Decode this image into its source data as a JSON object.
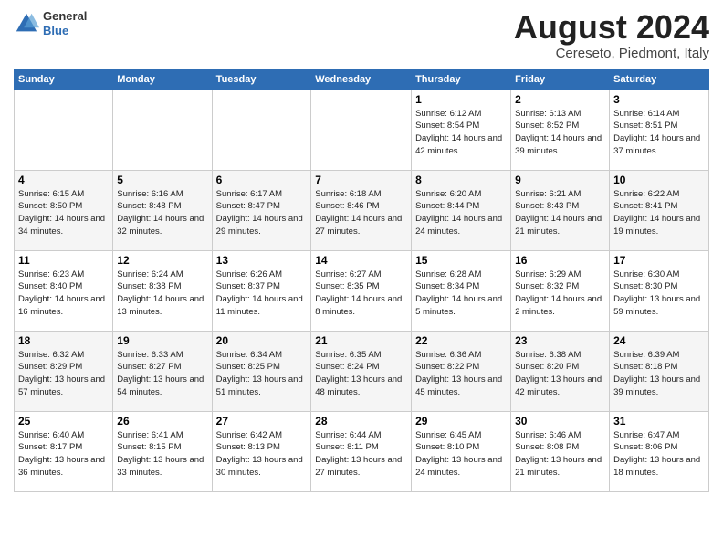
{
  "logo": {
    "general": "General",
    "blue": "Blue"
  },
  "title": "August 2024",
  "location": "Cereseto, Piedmont, Italy",
  "days_header": [
    "Sunday",
    "Monday",
    "Tuesday",
    "Wednesday",
    "Thursday",
    "Friday",
    "Saturday"
  ],
  "weeks": [
    [
      {
        "day": "",
        "info": ""
      },
      {
        "day": "",
        "info": ""
      },
      {
        "day": "",
        "info": ""
      },
      {
        "day": "",
        "info": ""
      },
      {
        "day": "1",
        "info": "Sunrise: 6:12 AM\nSunset: 8:54 PM\nDaylight: 14 hours\nand 42 minutes."
      },
      {
        "day": "2",
        "info": "Sunrise: 6:13 AM\nSunset: 8:52 PM\nDaylight: 14 hours\nand 39 minutes."
      },
      {
        "day": "3",
        "info": "Sunrise: 6:14 AM\nSunset: 8:51 PM\nDaylight: 14 hours\nand 37 minutes."
      }
    ],
    [
      {
        "day": "4",
        "info": "Sunrise: 6:15 AM\nSunset: 8:50 PM\nDaylight: 14 hours\nand 34 minutes."
      },
      {
        "day": "5",
        "info": "Sunrise: 6:16 AM\nSunset: 8:48 PM\nDaylight: 14 hours\nand 32 minutes."
      },
      {
        "day": "6",
        "info": "Sunrise: 6:17 AM\nSunset: 8:47 PM\nDaylight: 14 hours\nand 29 minutes."
      },
      {
        "day": "7",
        "info": "Sunrise: 6:18 AM\nSunset: 8:46 PM\nDaylight: 14 hours\nand 27 minutes."
      },
      {
        "day": "8",
        "info": "Sunrise: 6:20 AM\nSunset: 8:44 PM\nDaylight: 14 hours\nand 24 minutes."
      },
      {
        "day": "9",
        "info": "Sunrise: 6:21 AM\nSunset: 8:43 PM\nDaylight: 14 hours\nand 21 minutes."
      },
      {
        "day": "10",
        "info": "Sunrise: 6:22 AM\nSunset: 8:41 PM\nDaylight: 14 hours\nand 19 minutes."
      }
    ],
    [
      {
        "day": "11",
        "info": "Sunrise: 6:23 AM\nSunset: 8:40 PM\nDaylight: 14 hours\nand 16 minutes."
      },
      {
        "day": "12",
        "info": "Sunrise: 6:24 AM\nSunset: 8:38 PM\nDaylight: 14 hours\nand 13 minutes."
      },
      {
        "day": "13",
        "info": "Sunrise: 6:26 AM\nSunset: 8:37 PM\nDaylight: 14 hours\nand 11 minutes."
      },
      {
        "day": "14",
        "info": "Sunrise: 6:27 AM\nSunset: 8:35 PM\nDaylight: 14 hours\nand 8 minutes."
      },
      {
        "day": "15",
        "info": "Sunrise: 6:28 AM\nSunset: 8:34 PM\nDaylight: 14 hours\nand 5 minutes."
      },
      {
        "day": "16",
        "info": "Sunrise: 6:29 AM\nSunset: 8:32 PM\nDaylight: 14 hours\nand 2 minutes."
      },
      {
        "day": "17",
        "info": "Sunrise: 6:30 AM\nSunset: 8:30 PM\nDaylight: 13 hours\nand 59 minutes."
      }
    ],
    [
      {
        "day": "18",
        "info": "Sunrise: 6:32 AM\nSunset: 8:29 PM\nDaylight: 13 hours\nand 57 minutes."
      },
      {
        "day": "19",
        "info": "Sunrise: 6:33 AM\nSunset: 8:27 PM\nDaylight: 13 hours\nand 54 minutes."
      },
      {
        "day": "20",
        "info": "Sunrise: 6:34 AM\nSunset: 8:25 PM\nDaylight: 13 hours\nand 51 minutes."
      },
      {
        "day": "21",
        "info": "Sunrise: 6:35 AM\nSunset: 8:24 PM\nDaylight: 13 hours\nand 48 minutes."
      },
      {
        "day": "22",
        "info": "Sunrise: 6:36 AM\nSunset: 8:22 PM\nDaylight: 13 hours\nand 45 minutes."
      },
      {
        "day": "23",
        "info": "Sunrise: 6:38 AM\nSunset: 8:20 PM\nDaylight: 13 hours\nand 42 minutes."
      },
      {
        "day": "24",
        "info": "Sunrise: 6:39 AM\nSunset: 8:18 PM\nDaylight: 13 hours\nand 39 minutes."
      }
    ],
    [
      {
        "day": "25",
        "info": "Sunrise: 6:40 AM\nSunset: 8:17 PM\nDaylight: 13 hours\nand 36 minutes."
      },
      {
        "day": "26",
        "info": "Sunrise: 6:41 AM\nSunset: 8:15 PM\nDaylight: 13 hours\nand 33 minutes."
      },
      {
        "day": "27",
        "info": "Sunrise: 6:42 AM\nSunset: 8:13 PM\nDaylight: 13 hours\nand 30 minutes."
      },
      {
        "day": "28",
        "info": "Sunrise: 6:44 AM\nSunset: 8:11 PM\nDaylight: 13 hours\nand 27 minutes."
      },
      {
        "day": "29",
        "info": "Sunrise: 6:45 AM\nSunset: 8:10 PM\nDaylight: 13 hours\nand 24 minutes."
      },
      {
        "day": "30",
        "info": "Sunrise: 6:46 AM\nSunset: 8:08 PM\nDaylight: 13 hours\nand 21 minutes."
      },
      {
        "day": "31",
        "info": "Sunrise: 6:47 AM\nSunset: 8:06 PM\nDaylight: 13 hours\nand 18 minutes."
      }
    ]
  ]
}
